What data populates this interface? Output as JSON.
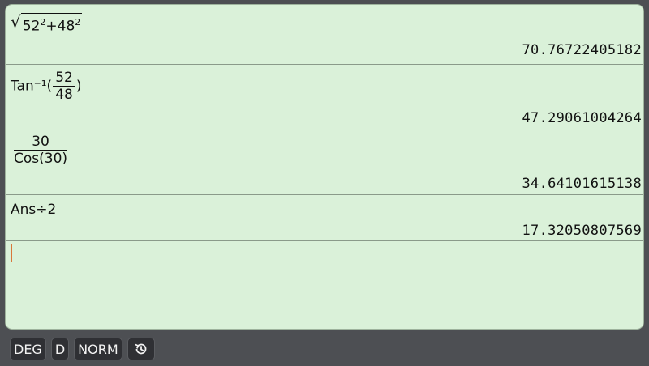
{
  "history": [
    {
      "kind": "sqrt",
      "a": "52",
      "a_exp": "2",
      "op": "+",
      "b": "48",
      "b_exp": "2",
      "result": "70.76722405182"
    },
    {
      "kind": "tan",
      "func": "Tan⁻¹(",
      "num": "52",
      "den": "48",
      "close": ")",
      "result": "47.29061004264"
    },
    {
      "kind": "frac",
      "num": "30",
      "den": "Cos(30)",
      "result": "34.64101615138"
    },
    {
      "kind": "plain",
      "expr": "Ans÷2",
      "result": "17.32050807569"
    }
  ],
  "status": {
    "angle": "DEG",
    "display": "D",
    "mode": "NORM",
    "history_icon": "history-icon"
  },
  "colors": {
    "screen_bg": "#daf1d9",
    "frame_bg": "#4d4f53",
    "cursor": "#d9773a"
  }
}
